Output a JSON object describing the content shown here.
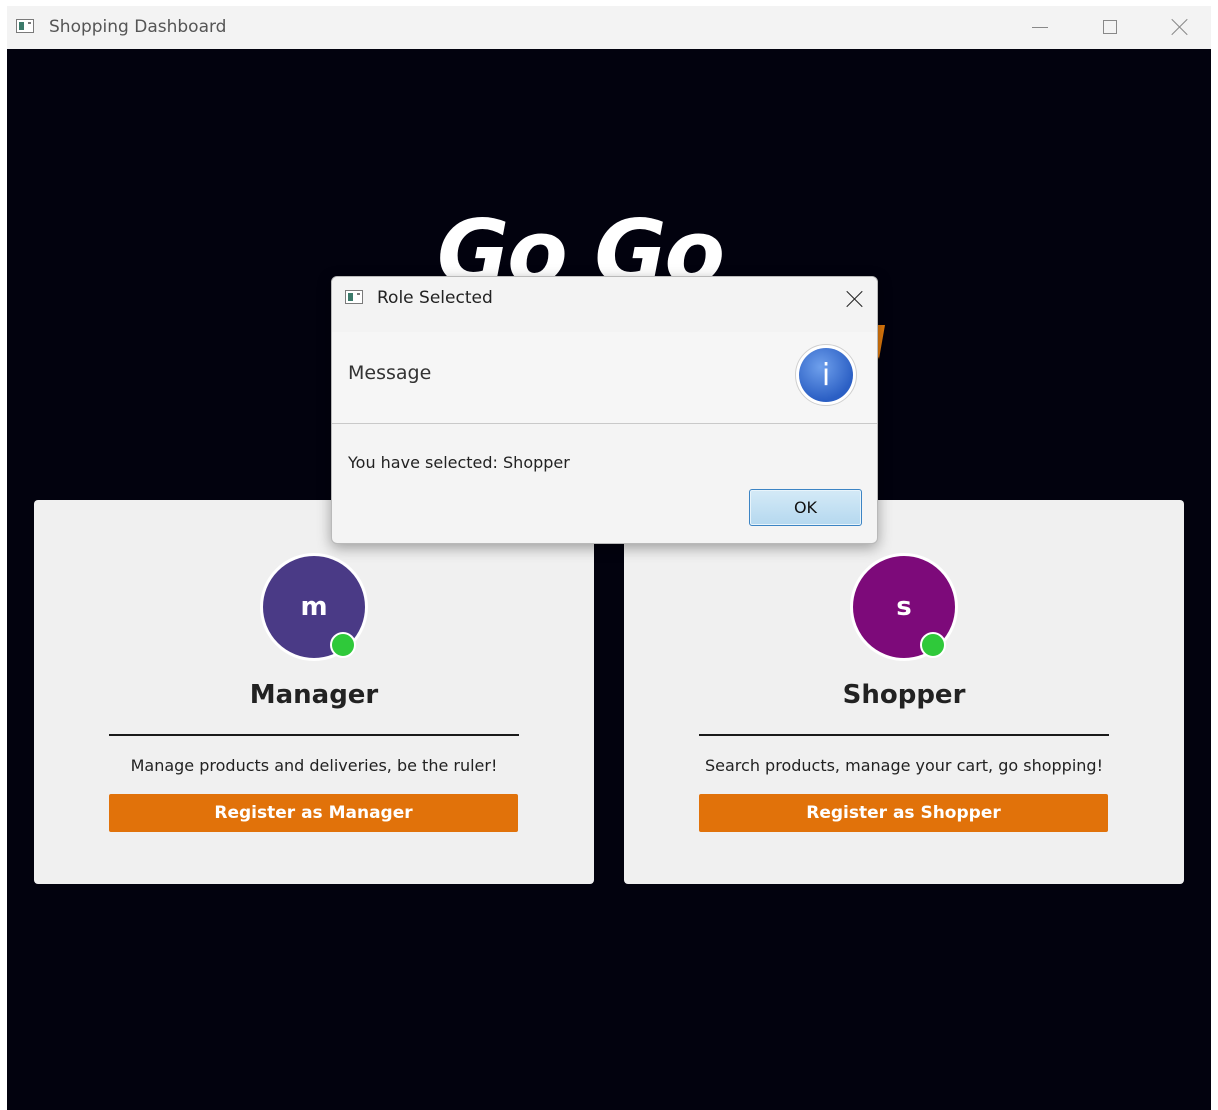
{
  "window": {
    "title": "Shopping Dashboard"
  },
  "logo": {
    "text": "Go Go"
  },
  "cards": [
    {
      "avatar_letter": "m",
      "avatar_color": "#4a3a86",
      "title": "Manager",
      "description": "Manage products and deliveries, be the ruler!",
      "button_label": "Register as Manager"
    },
    {
      "avatar_letter": "s",
      "avatar_color": "#7d0a7a",
      "title": "Shopper",
      "description": "Search products, manage your cart, go shopping!",
      "button_label": "Register as Shopper"
    }
  ],
  "dialog": {
    "title": "Role Selected",
    "header": "Message",
    "message": "You have selected: Shopper",
    "ok_label": "OK"
  },
  "colors": {
    "accent": "#e1720a",
    "background": "#02020e",
    "status_online": "#2fc93a"
  }
}
